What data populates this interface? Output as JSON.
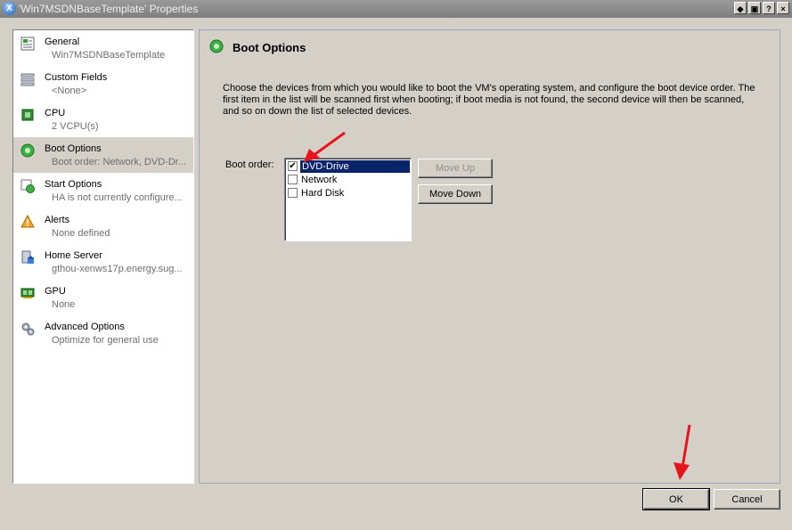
{
  "window": {
    "title": "'Win7MSDNBaseTemplate' Properties",
    "app_icon": "X",
    "controls": [
      "◆",
      "▣",
      "?",
      "×"
    ]
  },
  "sidebar": {
    "items": [
      {
        "name": "General",
        "sub": "Win7MSDNBaseTemplate",
        "icon": "general-icon"
      },
      {
        "name": "Custom Fields",
        "sub": "<None>",
        "icon": "custom-fields-icon"
      },
      {
        "name": "CPU",
        "sub": "2 VCPU(s)",
        "icon": "cpu-icon"
      },
      {
        "name": "Boot Options",
        "sub": "Boot order: Network, DVD-Dr...",
        "icon": "boot-options-icon",
        "selected": true
      },
      {
        "name": "Start Options",
        "sub": "HA is not currently configure...",
        "icon": "start-options-icon"
      },
      {
        "name": "Alerts",
        "sub": "None defined",
        "icon": "alert-icon"
      },
      {
        "name": "Home Server",
        "sub": "gthou-xenws17p.energy.sug...",
        "icon": "home-server-icon"
      },
      {
        "name": "GPU",
        "sub": "None",
        "icon": "gpu-icon"
      },
      {
        "name": "Advanced Options",
        "sub": "Optimize for general use",
        "icon": "advanced-options-icon"
      }
    ]
  },
  "panel": {
    "title": "Boot Options",
    "description": "Choose the devices from which you would like to boot the VM's operating system, and configure the boot device order. The first item in the list will be scanned first when booting; if boot media is not found, the second device will then be scanned, and so on down the list of selected devices.",
    "boot_order_label": "Boot order:",
    "boot_devices": [
      {
        "label": "DVD-Drive",
        "checked": true,
        "selected": true
      },
      {
        "label": "Network",
        "checked": false,
        "selected": false
      },
      {
        "label": "Hard Disk",
        "checked": false,
        "selected": false
      }
    ],
    "move_up": "Move Up",
    "move_down": "Move Down"
  },
  "footer": {
    "ok": "OK",
    "cancel": "Cancel"
  },
  "colors": {
    "selection": "#0a246a",
    "annotation_arrow": "#e8141b"
  }
}
